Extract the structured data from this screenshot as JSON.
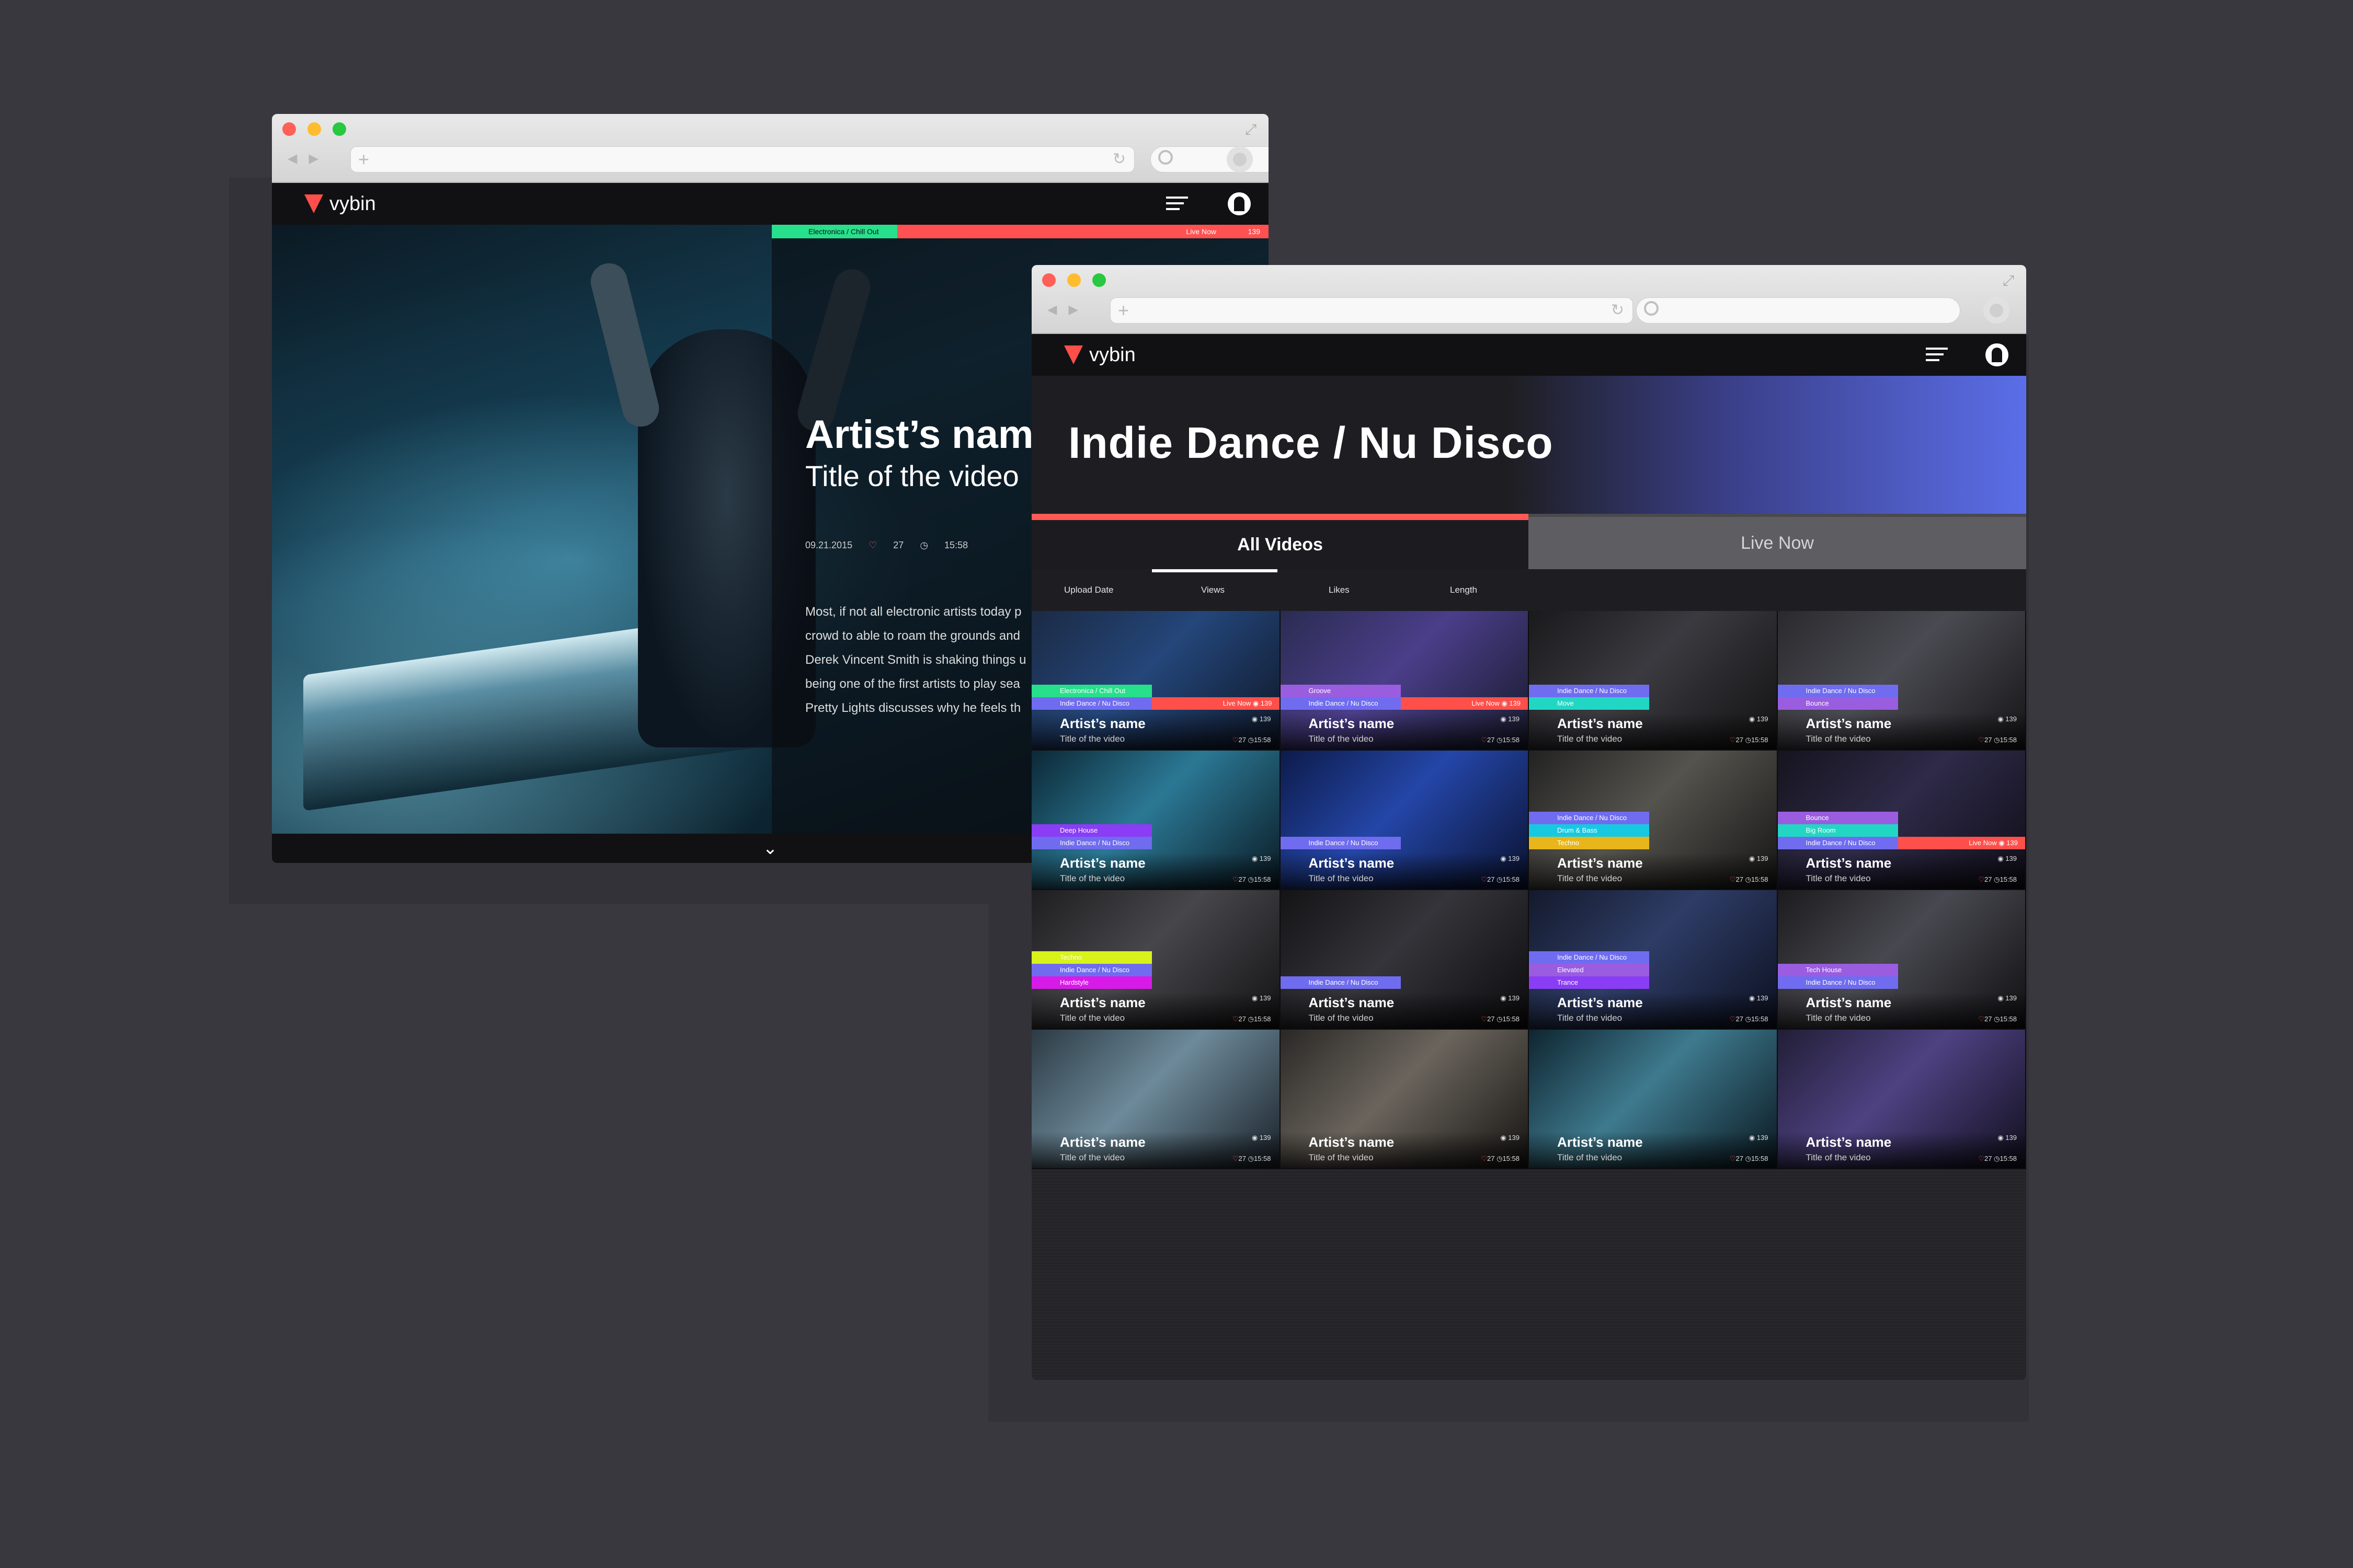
{
  "back_window": {
    "app": {
      "logo_text": "vybin"
    },
    "hero": {
      "category_tag": "Electronica / Chill Out",
      "live_label": "Live Now",
      "views": "139",
      "artist": "Artist’s name",
      "title": "Title of the video",
      "date": "09.21.2015",
      "likes": "27",
      "length": "15:58",
      "description_lines": [
        "Most, if not all electronic artists today p",
        "crowd to able to roam the grounds and",
        "Derek Vincent Smith is shaking things u",
        "being one of the first artists to play sea",
        "Pretty Lights discusses why he feels th"
      ]
    }
  },
  "front_window": {
    "app": {
      "logo_text": "vybin"
    },
    "page_title": "Indie Dance / Nu Disco",
    "tabs": [
      "All Videos",
      "Live Now"
    ],
    "sort_options": [
      "Upload Date",
      "Views",
      "Likes",
      "Length"
    ],
    "videos": [
      {
        "artist": "Artist’s name",
        "title": "Title of the video",
        "tags": [
          {
            "label": "Electronica / Chill Out",
            "color": "#27e08b"
          },
          {
            "label": "Indie Dance / Nu Disco",
            "color": "#6f6cf0"
          }
        ],
        "live": true,
        "live_label": "Live Now",
        "live_views": "139",
        "stat_top": "139",
        "likes": "27",
        "length": "15:58",
        "bg": "linear-gradient(135deg,#1b2a44,#24467a 45%,#0e1626)"
      },
      {
        "artist": "Artist’s name",
        "title": "Title of the video",
        "tags": [
          {
            "label": "Groove",
            "color": "#9a5de0"
          },
          {
            "label": "Indie Dance / Nu Disco",
            "color": "#6f6cf0"
          }
        ],
        "live": true,
        "live_label": "Live Now",
        "live_views": "139",
        "stat_top": "139",
        "likes": "27",
        "length": "15:58",
        "bg": "linear-gradient(135deg,#2a2c52,#4b3e8a 45%,#161a2a)"
      },
      {
        "artist": "Artist’s name",
        "title": "Title of the video",
        "tags": [
          {
            "label": "Indie Dance / Nu Disco",
            "color": "#6f6cf0"
          },
          {
            "label": "Move",
            "color": "#22d6c4"
          }
        ],
        "live": false,
        "stat_top": "139",
        "likes": "27",
        "length": "15:58",
        "bg": "linear-gradient(135deg,#1a1a1c,#3a3a40 45%,#111)"
      },
      {
        "artist": "Artist’s name",
        "title": "Title of the video",
        "tags": [
          {
            "label": "Indie Dance / Nu Disco",
            "color": "#6f6cf0"
          },
          {
            "label": "Bounce",
            "color": "#9a5de0"
          }
        ],
        "live": false,
        "stat_top": "139",
        "likes": "27",
        "length": "15:58",
        "bg": "linear-gradient(135deg,#2a2a2e,#4a4a52 45%,#151517)"
      },
      {
        "artist": "Artist’s name",
        "title": "Title of the video",
        "tags": [
          {
            "label": "Deep House",
            "color": "#8a3df5"
          },
          {
            "label": "Indie Dance / Nu Disco",
            "color": "#6f6cf0"
          }
        ],
        "live": false,
        "stat_top": "139",
        "likes": "27",
        "length": "15:58",
        "bg": "linear-gradient(135deg,#0c2836,#2b7894 45%,#0a1a24)"
      },
      {
        "artist": "Artist’s name",
        "title": "Title of the video",
        "tags": [
          {
            "label": "Indie Dance / Nu Disco",
            "color": "#6f6cf0"
          }
        ],
        "live": false,
        "stat_top": "139",
        "likes": "27",
        "length": "15:58",
        "bg": "linear-gradient(135deg,#0d1b4a,#2446a8 45%,#0a1230)"
      },
      {
        "artist": "Artist’s name",
        "title": "Title of the video",
        "tags": [
          {
            "label": "Indie Dance / Nu Disco",
            "color": "#6f6cf0"
          },
          {
            "label": "Drum & Bass",
            "color": "#17c9e0"
          },
          {
            "label": "Techno",
            "color": "#e8b61a"
          }
        ],
        "live": false,
        "stat_top": "139",
        "likes": "27",
        "length": "15:58",
        "bg": "linear-gradient(135deg,#222,#55534d 45%,#151515)"
      },
      {
        "artist": "Artist’s name",
        "title": "Title of the video",
        "tags": [
          {
            "label": "Bounce",
            "color": "#9a5de0"
          },
          {
            "label": "Big Room",
            "color": "#22d6c4"
          },
          {
            "label": "Indie Dance / Nu Disco",
            "color": "#6f6cf0"
          }
        ],
        "live": true,
        "live_label": "Live Now",
        "live_views": "139",
        "stat_top": "139",
        "likes": "27",
        "length": "15:58",
        "bg": "linear-gradient(135deg,#16141e,#2e2a48 45%,#0f0d16)"
      },
      {
        "artist": "Artist’s name",
        "title": "Title of the video",
        "tags": [
          {
            "label": "Techno",
            "color": "#d8f21a"
          },
          {
            "label": "Indie Dance / Nu Disco",
            "color": "#6f6cf0"
          },
          {
            "label": "Hardstyle",
            "color": "#d81ae8"
          }
        ],
        "live": false,
        "stat_top": "139",
        "likes": "27",
        "length": "15:58",
        "bg": "linear-gradient(135deg,#1e1e20,#47464a 45%,#121214)"
      },
      {
        "artist": "Artist’s name",
        "title": "Title of the video",
        "tags": [
          {
            "label": "Indie Dance / Nu Disco",
            "color": "#6f6cf0"
          }
        ],
        "live": false,
        "stat_top": "139",
        "likes": "27",
        "length": "15:58",
        "bg": "linear-gradient(135deg,#141416,#34343a 45%,#0c0c0e)"
      },
      {
        "artist": "Artist’s name",
        "title": "Title of the video",
        "tags": [
          {
            "label": "Indie Dance / Nu Disco",
            "color": "#6f6cf0"
          },
          {
            "label": "Elevated",
            "color": "#9a5de0"
          },
          {
            "label": "Trance",
            "color": "#8a3df5"
          }
        ],
        "live": false,
        "stat_top": "139",
        "likes": "27",
        "length": "15:58",
        "bg": "linear-gradient(135deg,#141a2c,#2e3c66 45%,#0c1020)"
      },
      {
        "artist": "Artist’s name",
        "title": "Title of the video",
        "tags": [
          {
            "label": "Tech House",
            "color": "#9a5de0"
          },
          {
            "label": "Indie Dance / Nu Disco",
            "color": "#6f6cf0"
          }
        ],
        "live": false,
        "stat_top": "139",
        "likes": "27",
        "length": "15:58",
        "bg": "linear-gradient(135deg,#1c1c1e,#484850 45%,#101012)"
      },
      {
        "artist": "Artist’s name",
        "title": "Title of the video",
        "tags": [],
        "live": false,
        "stat_top": "139",
        "likes": "27",
        "length": "15:58",
        "bg": "linear-gradient(135deg,#2c3a44,#6d8a9a 45%,#1a2128)"
      },
      {
        "artist": "Artist’s name",
        "title": "Title of the video",
        "tags": [],
        "live": false,
        "stat_top": "139",
        "likes": "27",
        "length": "15:58",
        "bg": "linear-gradient(135deg,#2a2826,#6a645c 45%,#161412)"
      },
      {
        "artist": "Artist’s name",
        "title": "Title of the video",
        "tags": [],
        "live": false,
        "stat_top": "139",
        "likes": "27",
        "length": "15:58",
        "bg": "linear-gradient(135deg,#0f2530,#3e7a8e 45%,#0a1820)"
      },
      {
        "artist": "Artist’s name",
        "title": "Title of the video",
        "tags": [],
        "live": false,
        "stat_top": "139",
        "likes": "27",
        "length": "15:58",
        "bg": "linear-gradient(135deg,#221e36,#4e4282 45%,#120f1e)"
      }
    ]
  },
  "colors": {
    "accent_red": "#ff4f4a",
    "accent_green": "#27e08b",
    "banner_blue": "#5b6ee8",
    "background": "#39383f"
  }
}
